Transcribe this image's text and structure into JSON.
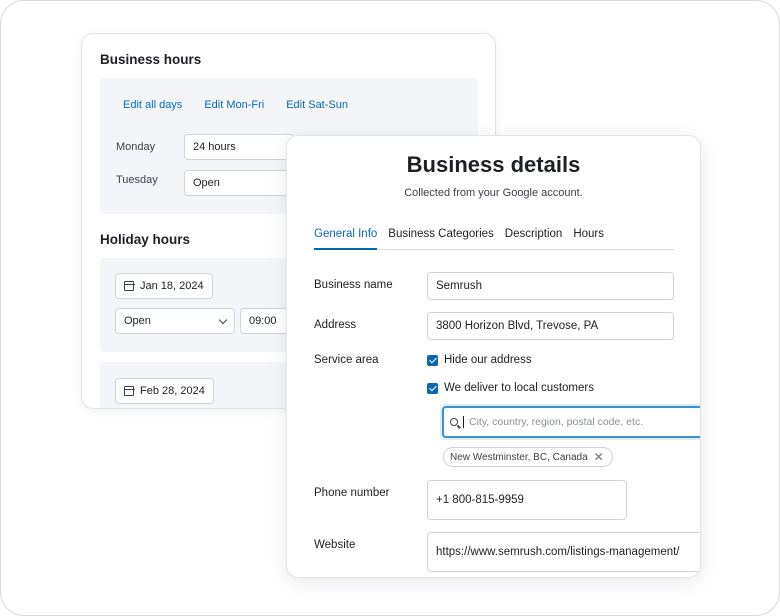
{
  "business_hours": {
    "title": "Business hours",
    "links": [
      "Edit all days",
      "Edit Mon-Fri",
      "Edit Sat-Sun"
    ],
    "days": [
      {
        "label": "Monday",
        "value": "24 hours"
      },
      {
        "label": "Tuesday",
        "value": "Open"
      }
    ]
  },
  "holiday_hours": {
    "title": "Holiday hours",
    "entries": [
      {
        "date": "Jan 18, 2024",
        "status": "Open",
        "time": "09:00"
      },
      {
        "date": "Feb 28, 2024"
      }
    ]
  },
  "business_details": {
    "title": "Business details",
    "subtitle": "Collected from your Google account.",
    "tabs": [
      {
        "label": "General Info",
        "active": true
      },
      {
        "label": "Business Categories",
        "active": false
      },
      {
        "label": "Description",
        "active": false
      },
      {
        "label": "Hours",
        "active": false
      }
    ],
    "fields": {
      "business_name": {
        "label": "Business name",
        "value": "Semrush"
      },
      "address": {
        "label": "Address",
        "value": "3800 Horizon Blvd, Trevose, PA"
      },
      "service_area": {
        "label": "Service area",
        "options": [
          {
            "label": "Hide our address",
            "checked": true
          },
          {
            "label": "We deliver to local customers",
            "checked": true
          }
        ],
        "search_placeholder": "City, country, region, postal code, etc.",
        "selected_areas": [
          "New Westminster, BC, Canada"
        ]
      },
      "phone": {
        "label": "Phone number",
        "value": "+1 800-815-9959"
      },
      "website": {
        "label": "Website",
        "value": "https://www.semrush.com/listings-management/"
      }
    }
  },
  "colors": {
    "accent": "#0a68b3",
    "panel": "#f3f5f9",
    "border": "#cfd3da"
  }
}
